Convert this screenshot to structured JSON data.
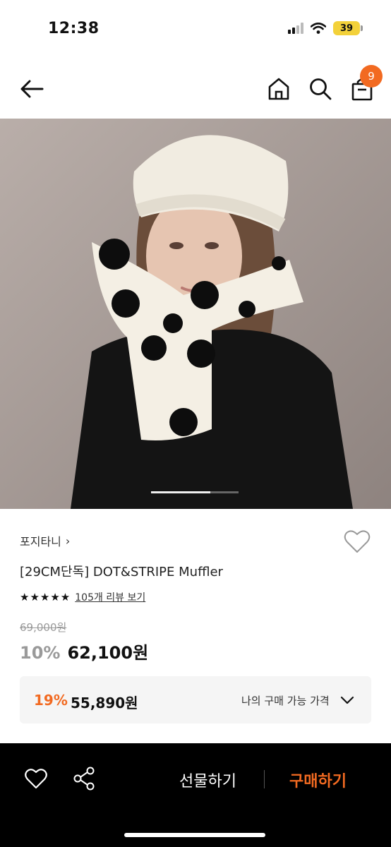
{
  "status_bar": {
    "time": "12:38",
    "battery": "39",
    "icons": [
      "signal-icon",
      "wifi-icon",
      "battery-icon"
    ]
  },
  "nav": {
    "back_icon": "arrow-left-icon",
    "home_icon": "home-icon",
    "search_icon": "search-icon",
    "bag_icon": "shopping-bag-icon",
    "cart_count": "9"
  },
  "hero": {
    "image_pages": 3,
    "current_page": 1
  },
  "product": {
    "brand": "포지타니",
    "brand_chevron": "›",
    "title": "[29CM단독] DOT&STRIPE Muffler",
    "stars": "★★★★★",
    "review_link": "105개 리뷰 보기",
    "original_price": "69,000원",
    "discount": "10%",
    "price": "62,100원",
    "wish_icon": "heart-outline-icon"
  },
  "member_price": {
    "discount": "19%",
    "price": "55,890원",
    "label": "나의 구매 가능 가격",
    "chevron_icon": "chevron-down-icon"
  },
  "bottom_bar": {
    "wish_icon": "heart-outline-icon",
    "share_icon": "share-icon",
    "gift_label": "선물하기",
    "buy_label": "구매하기"
  },
  "colors": {
    "accent": "#f26a21",
    "battery": "#f3d13a",
    "bottom_bar_bg": "#000000"
  }
}
